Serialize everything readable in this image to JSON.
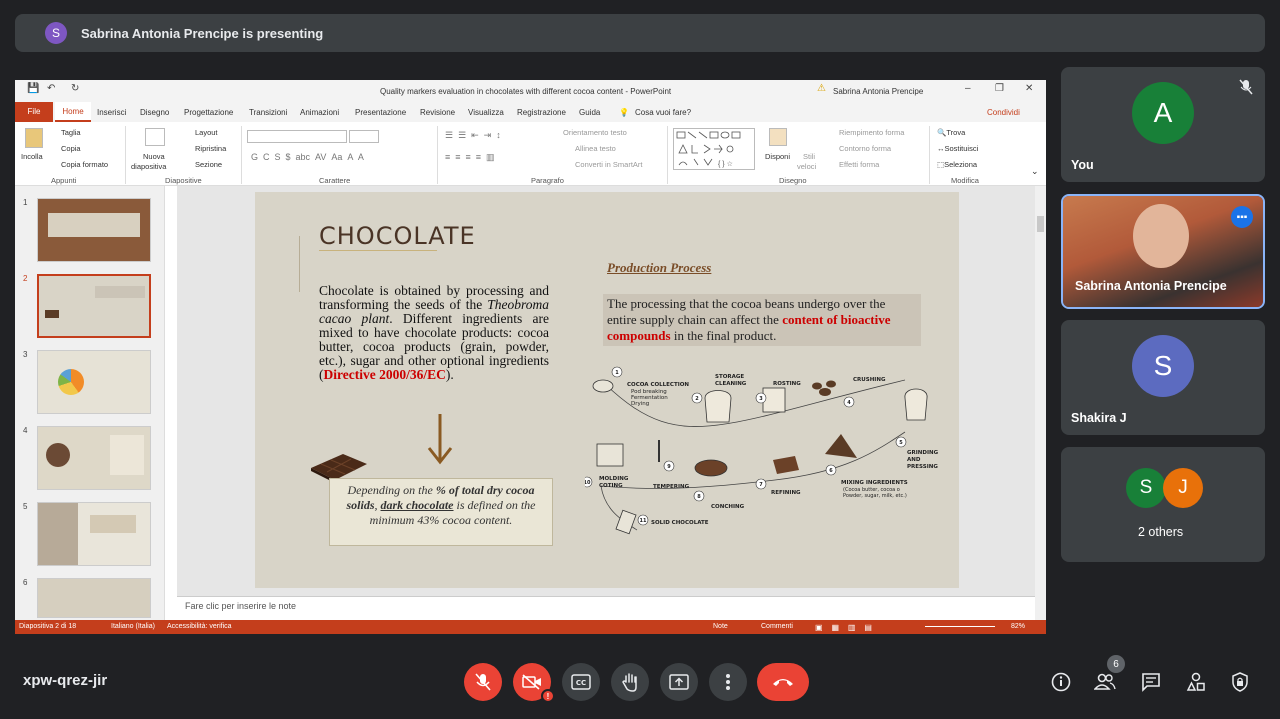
{
  "banner": {
    "avatar_letter": "S",
    "text": "Sabrina Antonia Prencipe is presenting"
  },
  "powerpoint": {
    "window_title_prefix": "Quality markers evaluation in chocolates with different cocoa content",
    "window_title_suffix": "  -  PowerPoint",
    "user_name": "Sabrina Antonia Prencipe",
    "tabs": [
      "File",
      "Home",
      "Inserisci",
      "Disegno",
      "Progettazione",
      "Transizioni",
      "Animazioni",
      "Presentazione",
      "Revisione",
      "Visualizza",
      "Registrazione",
      "Guida"
    ],
    "tell_me": "Cosa vuoi fare?",
    "share_label": "Condividi",
    "clipboard": {
      "paste": "Incolla",
      "cut": "Taglia",
      "copy": "Copia",
      "format_painter": "Copia formato",
      "group": "Appunti"
    },
    "slides_group": {
      "new_slide_1": "Nuova",
      "new_slide_2": "diapositiva",
      "layout": "Layout",
      "reset": "Ripristina",
      "section": "Sezione",
      "group": "Diapositive"
    },
    "font_group": {
      "label": "Carattere"
    },
    "paragraph_group": {
      "text_direction": "Orientamento testo",
      "align_text": "Allinea testo",
      "smartart": "Converti in SmartArt",
      "label": "Paragrafo"
    },
    "drawing_group": {
      "arrange": "Disponi",
      "quick_styles_1": "Stili",
      "quick_styles_2": "veloci",
      "fill": "Riempimento forma",
      "outline": "Contorno forma",
      "effects": "Effetti forma",
      "label": "Disegno"
    },
    "editing_group": {
      "find": "Trova",
      "replace": "Sostituisci",
      "select": "Seleziona",
      "label": "Modifica"
    },
    "thumb_numbers": [
      "1",
      "2",
      "3",
      "4",
      "5",
      "6"
    ],
    "notes_placeholder": "Fare clic per inserire le note",
    "status": {
      "slide": "Diapositiva 2 di 18",
      "language": "Italiano (Italia)",
      "accessibility": "Accessibilità: verifica",
      "notes": "Note",
      "comments": "Commenti",
      "zoom": "82%"
    }
  },
  "slide": {
    "title": "CHOCOLATE",
    "body_1": "Chocolate is obtained by processing and transforming the seeds of the ",
    "body_italic": "Theobroma cacao plant",
    "body_2": ". Different ingredients are mixed to have chocolate products: cocoa butter, cocoa products (grain, powder, etc.), sugar and other optional ingredients (",
    "body_red": "Directive 2000/36/EC",
    "body_3": ").",
    "box_1": "Depending on the ",
    "box_bold_1": "% of total dry cocoa solids",
    "box_2": ", ",
    "box_bold_2": "dark chocolate",
    "box_3": " is defined on the minimum 43% cocoa content.",
    "pp_title": "Production Process",
    "pp_text_1": "The processing that the cocoa beans undergo over the entire supply chain can affect the ",
    "pp_text_red": "content of bioactive compounds",
    "pp_text_2": " in the final product.",
    "steps": {
      "s1": "COCOA COLLECTION",
      "s1a": "Pod breaking",
      "s1b": "Fermentation",
      "s1c": "Drying",
      "s2": "STORAGE",
      "s2b": "CLEANING",
      "s3": "ROSTING",
      "s4": "CRUSHING",
      "s5": "GRINDING",
      "s5b": "AND",
      "s5c": "PRESSING",
      "s6": "MIXING INGREDIENTS",
      "s6b": "(Cocoa butter, cocoa o",
      "s6c": "Powder, sugar, milk, etc.)",
      "s7": "REFINING",
      "s8": "CONCHING",
      "s9": "TEMPERING",
      "s10": "MOLDING",
      "s10b": "COTING",
      "s11": "SOLID CHOCOLATE",
      "nums": [
        "1",
        "2",
        "3",
        "4",
        "5",
        "6",
        "7",
        "8",
        "9",
        "10",
        "11"
      ]
    }
  },
  "participants": [
    {
      "name": "You",
      "letter": "A",
      "color": "#188038"
    },
    {
      "name": "Sabrina Antonia Prencipe"
    },
    {
      "name": "Shakira J",
      "letter": "S",
      "color": "#5c6bc0"
    },
    {
      "name": "2 others",
      "letters": [
        "S",
        "J"
      ],
      "colors": [
        "#188038",
        "#e8710a"
      ]
    }
  ],
  "bottom": {
    "meeting_code": "xpw-qrez-jir",
    "people_count": "6"
  }
}
